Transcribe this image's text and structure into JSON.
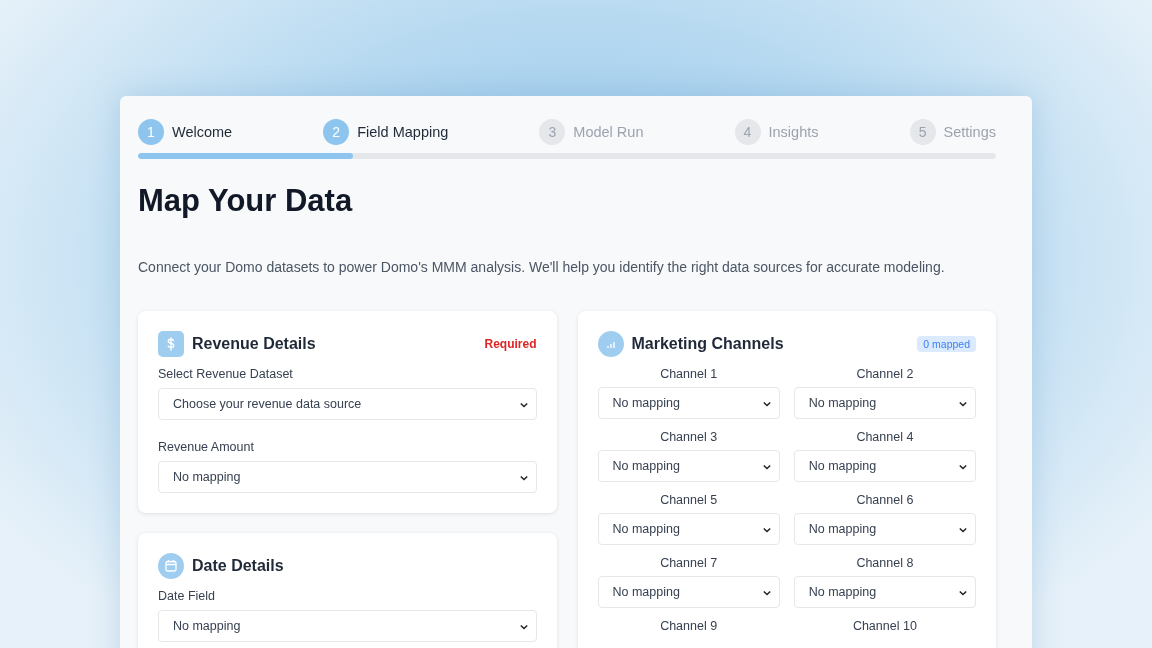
{
  "steps": [
    {
      "number": "1",
      "label": "Welcome",
      "reached": true
    },
    {
      "number": "2",
      "label": "Field Mapping",
      "reached": true
    },
    {
      "number": "3",
      "label": "Model Run",
      "reached": false
    },
    {
      "number": "4",
      "label": "Insights",
      "reached": false
    },
    {
      "number": "5",
      "label": "Settings",
      "reached": false
    }
  ],
  "progress": {
    "level": 0.25
  },
  "title": "Map Your Data",
  "description": "Connect your Domo datasets to power Domo's MMM analysis. We'll help you identify the right data sources for accurate modeling.",
  "revenue": {
    "title": "Revenue Details",
    "badge": "Required",
    "fields": [
      {
        "label": "Select Revenue Dataset",
        "value": "Choose your revenue data source"
      },
      {
        "label": "Revenue Amount",
        "value": "No mapping"
      }
    ]
  },
  "date": {
    "title": "Date Details",
    "fields": [
      {
        "label": "Date Field",
        "value": "No mapping"
      }
    ]
  },
  "marketing": {
    "title": "Marketing Channels",
    "badge": "0 mapped",
    "channels": [
      {
        "label": "Channel 1",
        "value": "No mapping"
      },
      {
        "label": "Channel 2",
        "value": "No mapping"
      },
      {
        "label": "Channel 3",
        "value": "No mapping"
      },
      {
        "label": "Channel 4",
        "value": "No mapping"
      },
      {
        "label": "Channel 5",
        "value": "No mapping"
      },
      {
        "label": "Channel 6",
        "value": "No mapping"
      },
      {
        "label": "Channel 7",
        "value": "No mapping"
      },
      {
        "label": "Channel 8",
        "value": "No mapping"
      },
      {
        "label": "Channel 9"
      },
      {
        "label": "Channel 10"
      }
    ]
  }
}
